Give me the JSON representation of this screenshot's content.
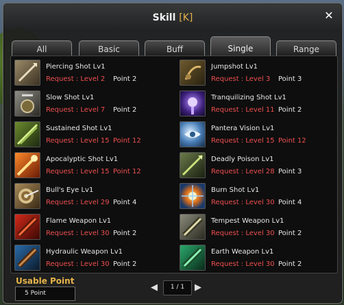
{
  "window": {
    "title": "Skill",
    "hotkey": "[K]"
  },
  "tabs": [
    {
      "label": "All"
    },
    {
      "label": "Basic"
    },
    {
      "label": "Buff"
    },
    {
      "label": "Single",
      "active": true
    },
    {
      "label": "Range"
    }
  ],
  "skills": [
    {
      "name": "Piercing Shot Lv1",
      "request": "Request : Level  2",
      "point": "Point  2",
      "point_ok": true,
      "icon": "piercing-shot-icon"
    },
    {
      "name": "Jumpshot Lv1",
      "request": "Request : Level  3",
      "point": "Point  3",
      "point_ok": true,
      "icon": "jumpshot-icon"
    },
    {
      "name": "Slow Shot Lv1",
      "request": "Request : Level  7",
      "point": "Point  2",
      "point_ok": true,
      "icon": "slow-shot-icon"
    },
    {
      "name": "Tranquilizing Shot Lv1",
      "request": "Request : Level 11",
      "point": "Point  2",
      "point_ok": true,
      "icon": "tranquilizing-shot-icon"
    },
    {
      "name": "Sustained Shot Lv1",
      "request": "Request : Level 15",
      "point": "Point 12",
      "point_ok": false,
      "icon": "sustained-shot-icon"
    },
    {
      "name": "Pantera Vision Lv1",
      "request": "Request : Level 15",
      "point": "Point 12",
      "point_ok": false,
      "icon": "pantera-vision-icon"
    },
    {
      "name": "Apocalyptic Shot Lv1",
      "request": "Request : Level 15",
      "point": "Point 12",
      "point_ok": false,
      "icon": "apocalyptic-shot-icon"
    },
    {
      "name": "Deadly Poison Lv1",
      "request": "Request : Level 28",
      "point": "Point  3",
      "point_ok": true,
      "icon": "deadly-poison-icon"
    },
    {
      "name": "Bull's Eye Lv1",
      "request": "Request : Level 29",
      "point": "Point  4",
      "point_ok": true,
      "icon": "bulls-eye-icon"
    },
    {
      "name": "Burn Shot Lv1",
      "request": "Request : Level 30",
      "point": "Point  4",
      "point_ok": true,
      "icon": "burn-shot-icon"
    },
    {
      "name": "Flame Weapon Lv1",
      "request": "Request : Level 30",
      "point": "Point  2",
      "point_ok": true,
      "icon": "flame-weapon-icon"
    },
    {
      "name": "Tempest Weapon Lv1",
      "request": "Request : Level 30",
      "point": "Point  2",
      "point_ok": true,
      "icon": "tempest-weapon-icon"
    },
    {
      "name": "Hydraulic Weapon Lv1",
      "request": "Request : Level 30",
      "point": "Point  2",
      "point_ok": true,
      "icon": "hydraulic-weapon-icon"
    },
    {
      "name": "Earth Weapon Lv1",
      "request": "Request : Level 30",
      "point": "Point  2",
      "point_ok": true,
      "icon": "earth-weapon-icon"
    }
  ],
  "usable_point": {
    "label": "Usable Point",
    "value": "5 Point"
  },
  "pager": {
    "text": "1 / 1"
  },
  "colors": {
    "accent": "#e6b34a",
    "requirement": "#ee4f4f",
    "text": "#e8e8e8"
  }
}
